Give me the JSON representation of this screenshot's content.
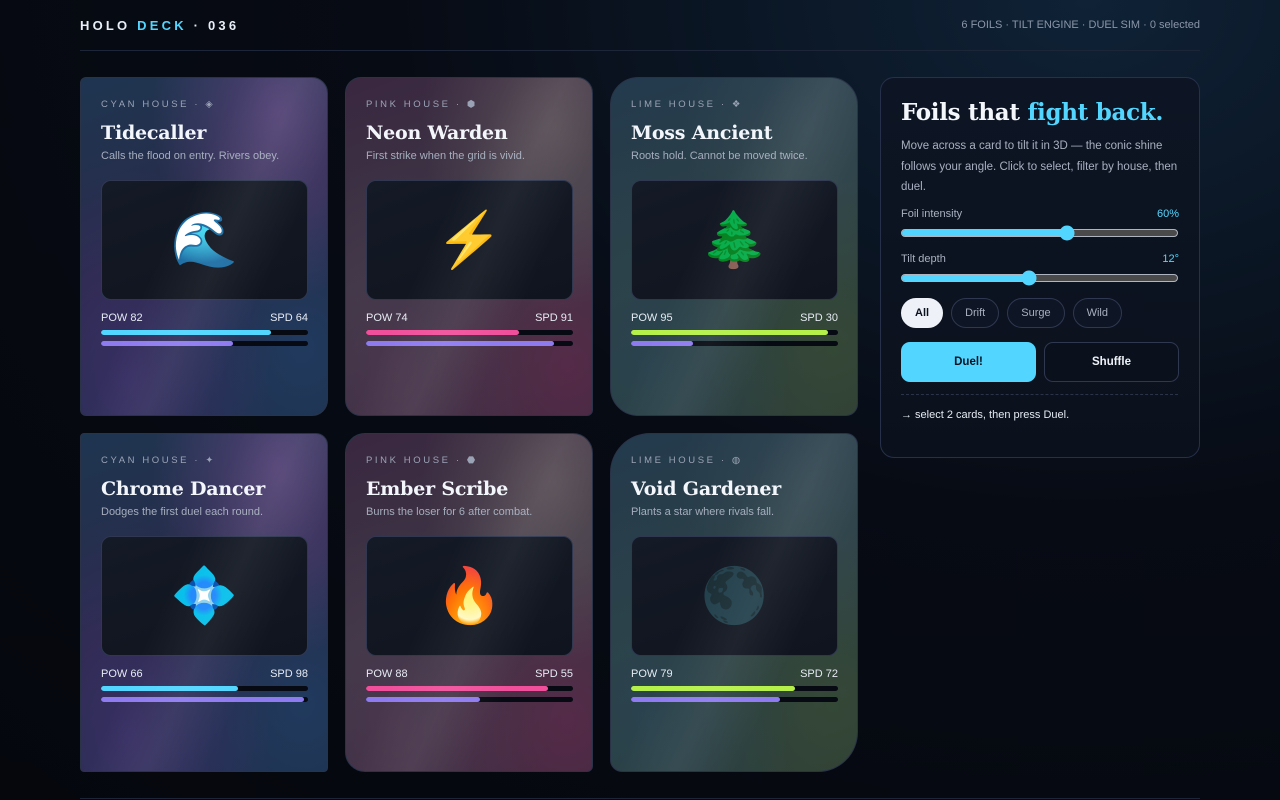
{
  "header": {
    "brand_prefix": "HOLO ",
    "brand_accent": "DECK",
    "brand_suffix": " · 036",
    "status": "6 FOILS · TILT ENGINE · DUEL SIM · 0 selected"
  },
  "colors": {
    "accent": "#52d6ff",
    "cyan": "#52d6ff",
    "pink": "#f0509b",
    "lime": "#b5f04a",
    "speed": "#8f7bf0"
  },
  "cards": [
    {
      "house": "CYAN HOUSE · ◈",
      "name": "Tidecaller",
      "desc": "Calls the flood on entry. Rivers obey.",
      "art": "🌊",
      "art_icon": "wave-icon",
      "pow_label": "POW 82",
      "spd_label": "SPD 64",
      "pow": 82,
      "spd": 64,
      "color": "#52d6ff"
    },
    {
      "house": "PINK HOUSE · ⬢",
      "name": "Neon Warden",
      "desc": "First strike when the grid is vivid.",
      "art": "⚡",
      "art_icon": "lightning-icon",
      "pow_label": "POW 74",
      "spd_label": "SPD 91",
      "pow": 74,
      "spd": 91,
      "color": "#f0509b"
    },
    {
      "house": "LIME HOUSE · ❖",
      "name": "Moss Ancient",
      "desc": "Roots hold. Cannot be moved twice.",
      "art": "🌲",
      "art_icon": "tree-icon",
      "pow_label": "POW 95",
      "spd_label": "SPD 30",
      "pow": 95,
      "spd": 30,
      "color": "#b5f04a"
    },
    {
      "house": "CYAN HOUSE · ✦",
      "name": "Chrome Dancer",
      "desc": "Dodges the first duel each round.",
      "art": "💠",
      "art_icon": "diamond-icon",
      "pow_label": "POW 66",
      "spd_label": "SPD 98",
      "pow": 66,
      "spd": 98,
      "color": "#52d6ff"
    },
    {
      "house": "PINK HOUSE · ⬣",
      "name": "Ember Scribe",
      "desc": "Burns the loser for 6 after combat.",
      "art": "🔥",
      "art_icon": "fire-icon",
      "pow_label": "POW 88",
      "spd_label": "SPD 55",
      "pow": 88,
      "spd": 55,
      "color": "#f0509b"
    },
    {
      "house": "LIME HOUSE · ◍",
      "name": "Void Gardener",
      "desc": "Plants a star where rivals fall.",
      "art": "🌑",
      "art_icon": "moon-icon",
      "pow_label": "POW 79",
      "spd_label": "SPD 72",
      "pow": 79,
      "spd": 72,
      "color": "#b5f04a"
    }
  ],
  "panel": {
    "title_prefix": "Foils that ",
    "title_accent": "fight back.",
    "intro": "Move across a card to tilt it in 3D — the conic shine follows your angle. Click to select, filter by house, then duel.",
    "foil": {
      "label": "Foil intensity",
      "value_label": "60%",
      "value": 0.6
    },
    "tilt": {
      "label": "Tilt depth",
      "value_label": "12°",
      "value": 0.46
    },
    "filters": [
      "All",
      "Drift",
      "Surge",
      "Wild"
    ],
    "active_filter": "All",
    "duel_label": "Duel!",
    "shuffle_label": "Shuffle",
    "hint": "→ select 2 cards, then press Duel."
  }
}
